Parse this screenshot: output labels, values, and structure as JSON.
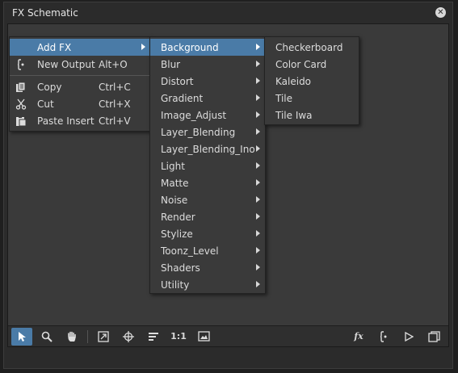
{
  "window": {
    "title": "FX Schematic"
  },
  "menu": {
    "items": [
      {
        "label": "Add FX",
        "shortcut": "",
        "icon": "",
        "highlighted": true,
        "submenu": true
      },
      {
        "label": "New Output",
        "shortcut": "Alt+O",
        "icon": "output-icon"
      },
      {
        "label": "Copy",
        "shortcut": "Ctrl+C",
        "icon": "copy-icon"
      },
      {
        "label": "Cut",
        "shortcut": "Ctrl+X",
        "icon": "scissors-icon"
      },
      {
        "label": "Paste Insert",
        "shortcut": "Ctrl+V",
        "icon": "paste-icon"
      }
    ]
  },
  "fx_categories": [
    "Background",
    "Blur",
    "Distort",
    "Gradient",
    "Image_Adjust",
    "Layer_Blending",
    "Layer_Blending_Ino",
    "Light",
    "Matte",
    "Noise",
    "Render",
    "Stylize",
    "Toonz_Level",
    "Shaders",
    "Utility"
  ],
  "background_fx": [
    "Checkerboard",
    "Color Card",
    "Kaleido",
    "Tile",
    "Tile Iwa"
  ],
  "toolbar": {
    "actual_size_label": "1:1",
    "fx_label": "fx"
  },
  "colors": {
    "highlight": "#4a7ba7",
    "menu_bg": "#3a3a3a",
    "window_bg": "#2b2b2b"
  }
}
